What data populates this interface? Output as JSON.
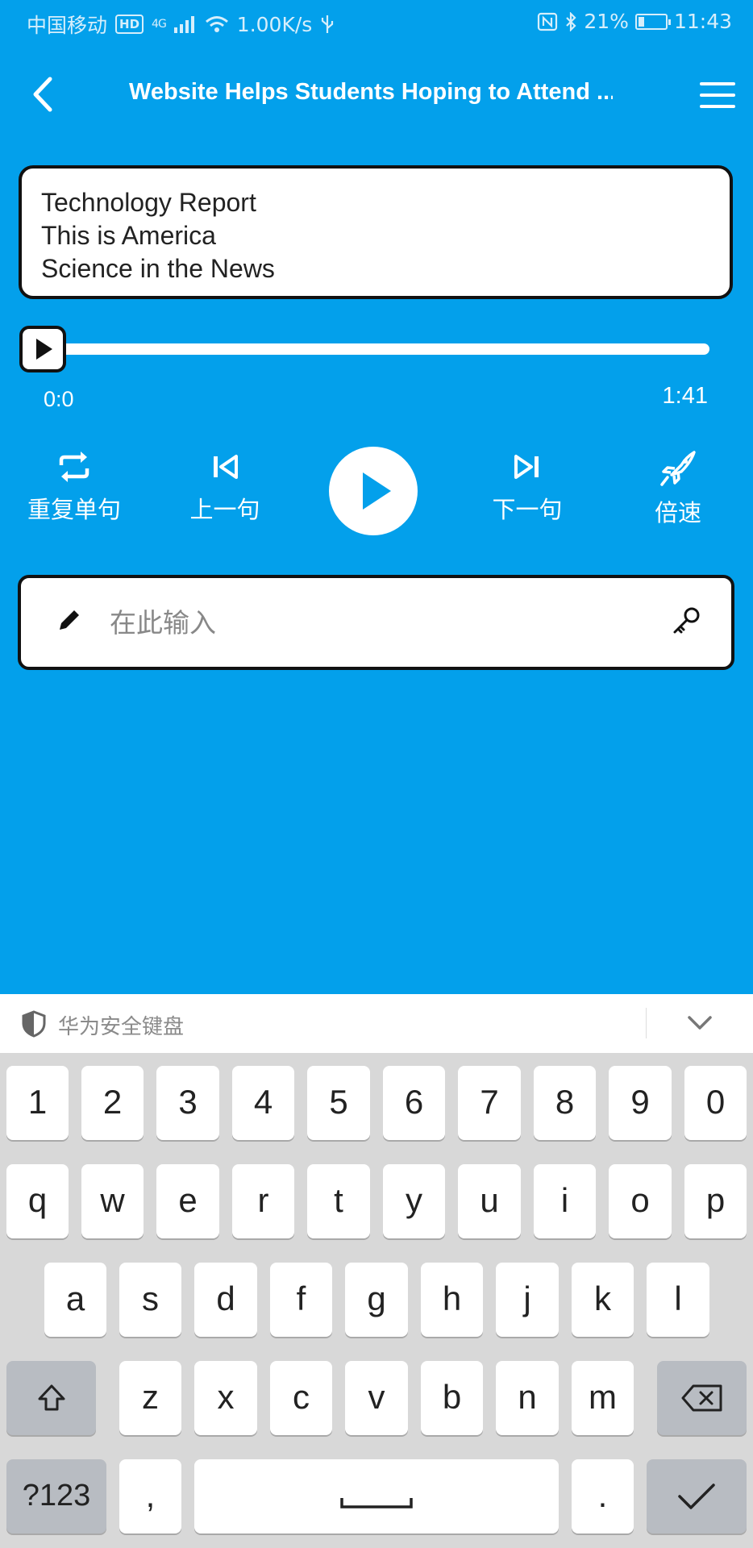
{
  "status_bar": {
    "carrier": "中国移动",
    "hd": "HD",
    "network": "4G",
    "speed": "1.00K/s",
    "battery_percent": "21%",
    "battery_level": 0.21,
    "time": "11:43"
  },
  "header": {
    "title": "Website Helps Students Hoping to Attend ...",
    "back_icon": "chevron-left-icon",
    "menu_icon": "hamburger-menu-icon"
  },
  "text_card": {
    "lines": [
      "Technology Report",
      "This is America",
      "Science in the News"
    ]
  },
  "player": {
    "current_time": "0:0",
    "total_time": "1:41",
    "progress": 0.0,
    "controls": {
      "repeat_label": "重复单句",
      "prev_label": "上一句",
      "next_label": "下一句",
      "speed_label": "倍速"
    }
  },
  "input": {
    "placeholder": "在此输入",
    "value": ""
  },
  "keyboard": {
    "title": "华为安全键盘",
    "row_numbers": [
      "1",
      "2",
      "3",
      "4",
      "5",
      "6",
      "7",
      "8",
      "9",
      "0"
    ],
    "row_1": [
      "q",
      "w",
      "e",
      "r",
      "t",
      "y",
      "u",
      "i",
      "o",
      "p"
    ],
    "row_2": [
      "a",
      "s",
      "d",
      "f",
      "g",
      "h",
      "j",
      "k",
      "l"
    ],
    "row_3": [
      "z",
      "x",
      "c",
      "v",
      "b",
      "n",
      "m"
    ],
    "symbols_label": "?123",
    "comma": ",",
    "period": "."
  },
  "colors": {
    "background": "#03A0EB",
    "card": "#FFFFFF",
    "border": "#111111"
  }
}
